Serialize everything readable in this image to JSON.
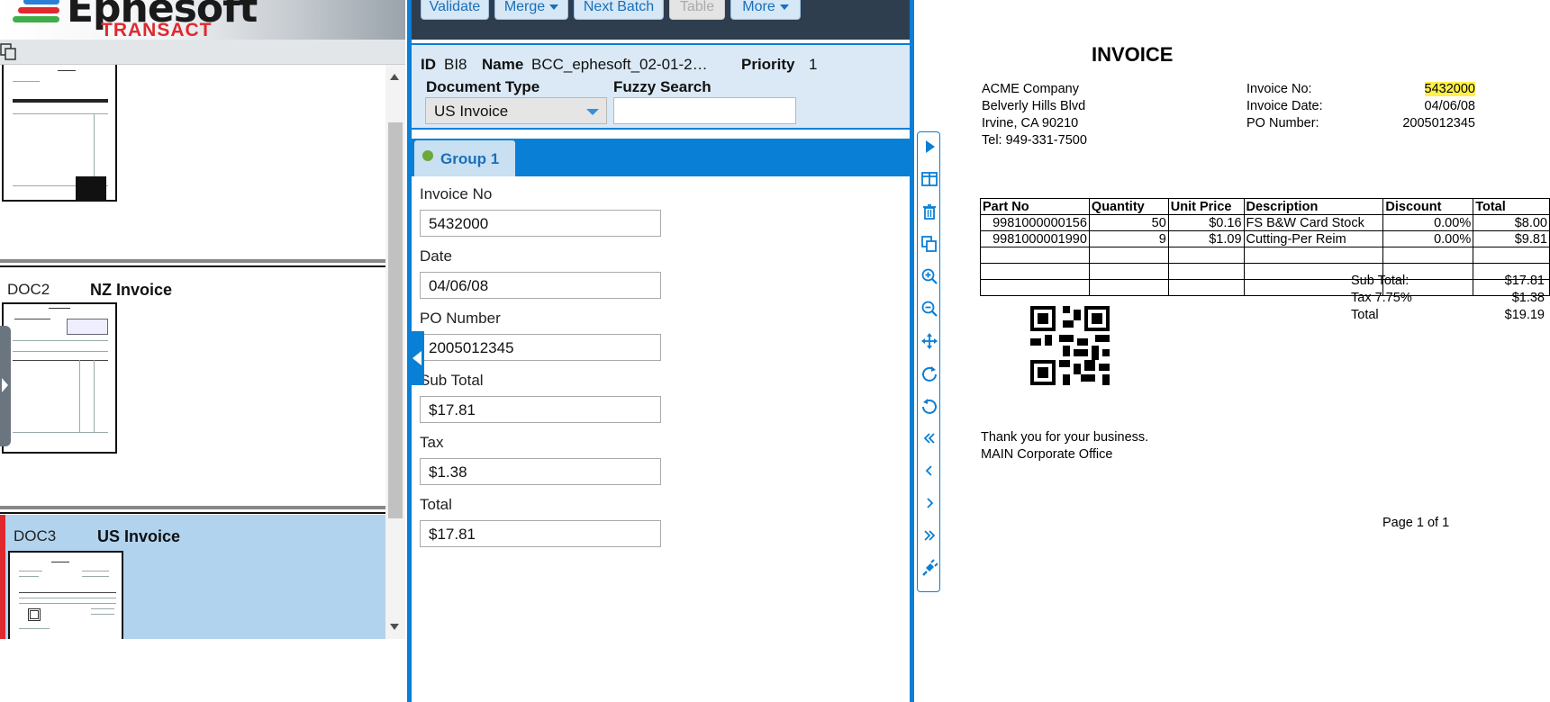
{
  "app": {
    "logo_brand": "Ephesoft",
    "logo_sub": "TRANSACT",
    "logo_colors": [
      "#3fae49",
      "#e0292f",
      "#2a7fd6"
    ]
  },
  "toolbar": {
    "buttons": [
      {
        "label": "Validate",
        "dropdown": false,
        "disabled": false
      },
      {
        "label": "Merge",
        "dropdown": true,
        "disabled": false
      },
      {
        "label": "Next Batch",
        "dropdown": false,
        "disabled": false
      },
      {
        "label": "Table",
        "dropdown": false,
        "disabled": true
      },
      {
        "label": "More",
        "dropdown": true,
        "disabled": false
      }
    ]
  },
  "batch": {
    "id_label": "ID",
    "id_value": "BI8",
    "name_label": "Name",
    "name_value": "BCC_ephesoft_02-01-2…",
    "priority_label": "Priority",
    "priority_value": "1",
    "doc_type_label": "Document Type",
    "doc_type_value": "US Invoice",
    "fuzzy_label": "Fuzzy Search",
    "fuzzy_value": ""
  },
  "documents": [
    {
      "id": "",
      "type": ""
    },
    {
      "id": "DOC2",
      "type": "NZ Invoice"
    },
    {
      "id": "DOC3",
      "type": "US Invoice",
      "selected": true
    }
  ],
  "group": {
    "label": "Group 1",
    "status_color": "#6aa93a"
  },
  "fields": [
    {
      "label": "Invoice No",
      "value": "5432000"
    },
    {
      "label": "Date",
      "value": "04/06/08"
    },
    {
      "label": "PO Number",
      "value": "2005012345"
    },
    {
      "label": "Sub Total",
      "value": "$17.81"
    },
    {
      "label": "Tax",
      "value": "$1.38"
    },
    {
      "label": "Total",
      "value": "$17.81"
    }
  ],
  "viewer_tools": [
    "play-icon",
    "split-view-icon",
    "trash-icon",
    "copy-icon",
    "zoom-in-icon",
    "zoom-out-icon",
    "move-icon",
    "rotate-cw-icon",
    "rotate-ccw-icon",
    "first-page-icon",
    "prev-page-icon",
    "next-page-icon",
    "last-page-icon",
    "plugin-icon"
  ],
  "invoice": {
    "title": "INVOICE",
    "company": [
      "ACME Company",
      "Belverly Hills Blvd",
      "Irvine, CA 90210",
      "Tel: 949-331-7500"
    ],
    "meta": [
      {
        "label": "Invoice No:",
        "value": "5432000"
      },
      {
        "label": "Invoice Date:",
        "value": "04/06/08"
      },
      {
        "label": "PO Number:",
        "value": "2005012345"
      }
    ],
    "columns": [
      "Part No",
      "Quantity",
      "Unit Price",
      "Description",
      "Discount",
      "Total"
    ],
    "rows": [
      [
        "9981000000156",
        "50",
        "$0.16",
        "FS B&W Card Stock",
        "0.00%",
        "$8.00"
      ],
      [
        "9981000001990",
        "9",
        "$1.09",
        "Cutting-Per Reim",
        "0.00%",
        "$9.81"
      ]
    ],
    "totals": [
      {
        "label": "Sub Total:",
        "value": "$17.81"
      },
      {
        "label": "Tax 7.75%",
        "value": "$1.38"
      },
      {
        "label": "Total",
        "value": "$19.19"
      }
    ],
    "footer": [
      "Thank you for your business.",
      "MAIN Corporate Office"
    ],
    "page": "Page 1 of 1",
    "highlight_color": "#fff04a"
  }
}
